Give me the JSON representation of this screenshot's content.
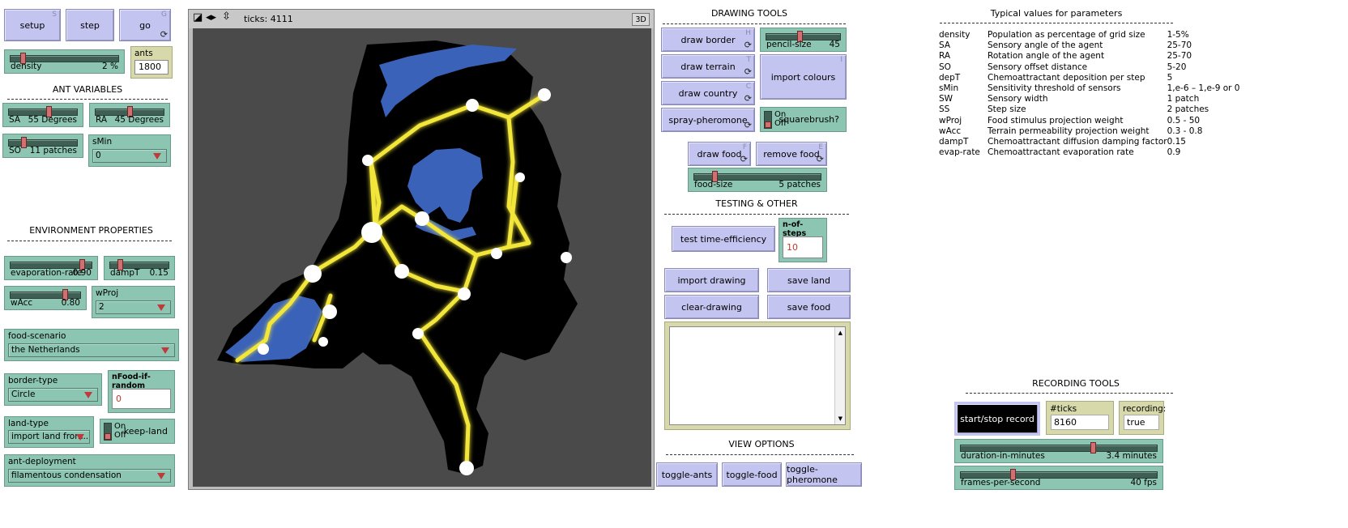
{
  "buttons": {
    "setup": {
      "label": "setup",
      "key": "S"
    },
    "step": {
      "label": "step"
    },
    "go": {
      "label": "go",
      "key": "G"
    }
  },
  "density": {
    "label": "density",
    "value": "2 %",
    "fraction": 0.1
  },
  "ants": {
    "label": "ants",
    "value": "1800"
  },
  "sections": {
    "ant_variables": "ANT VARIABLES",
    "environment": "ENVIRONMENT PROPERTIES",
    "drawing_tools": "DRAWING TOOLS",
    "testing": "TESTING & OTHER",
    "view_options": "VIEW OPTIONS",
    "typical_values": "Typical values for parameters",
    "recording_tools": "RECORDING TOOLS"
  },
  "sliders": {
    "sa": {
      "label": "SA",
      "value": "55 Degrees",
      "fraction": 0.6
    },
    "ra": {
      "label": "RA",
      "value": "45 Degrees",
      "fraction": 0.5
    },
    "so": {
      "label": "SO",
      "value": "11 patches",
      "fraction": 0.2
    },
    "evaporation": {
      "label": "evaporation-rate",
      "value": "0.90",
      "fraction": 0.9
    },
    "dampt": {
      "label": "dampT",
      "value": "0.15",
      "fraction": 0.15
    },
    "wacc": {
      "label": "wAcc",
      "value": "0.80",
      "fraction": 0.8
    },
    "pencil": {
      "label": "pencil-size",
      "value": "45",
      "fraction": 0.45
    },
    "food_size": {
      "label": "food-size",
      "value": "5 patches",
      "fraction": 0.15
    },
    "duration": {
      "label": "duration-in-minutes",
      "value": "3.4 minutes",
      "fraction": 0.68
    },
    "fps": {
      "label": "frames-per-second",
      "value": "40 fps",
      "fraction": 0.26
    }
  },
  "choosers": {
    "smin": {
      "label": "sMin",
      "value": "0"
    },
    "wproj": {
      "label": "wProj",
      "value": "2"
    },
    "food_scenario": {
      "label": "food-scenario",
      "value": "the Netherlands"
    },
    "border_type": {
      "label": "border-type",
      "value": "Circle"
    },
    "land_type": {
      "label": "land-type",
      "value": "import land from..."
    },
    "ant_deployment": {
      "label": "ant-deployment",
      "value": "filamentous condensation"
    }
  },
  "inputs": {
    "nfood": {
      "label": "nFood-if-random",
      "value": "0"
    },
    "nsteps": {
      "label": "n-of-steps",
      "value": "10"
    }
  },
  "switches": {
    "keep_land": {
      "label": "keep-land",
      "on": "On",
      "off": "Off"
    },
    "squarebrush": {
      "label": "squarebrush?",
      "on": "On",
      "off": "Off"
    }
  },
  "view": {
    "ticks": "ticks: 4111",
    "btn3d": "3D"
  },
  "draw_buttons": {
    "draw_border": {
      "label": "draw border",
      "key": "H"
    },
    "draw_terrain": {
      "label": "draw terrain",
      "key": "T"
    },
    "draw_country": {
      "label": "draw country",
      "key": "C"
    },
    "spray": {
      "label": "spray-pheromone"
    },
    "import_colours": {
      "label": "import colours",
      "key": "I"
    },
    "draw_food": {
      "label": "draw food",
      "key": "F"
    },
    "remove_food": {
      "label": "remove food",
      "key": "E"
    },
    "test_eff": {
      "label": "test time-efficiency"
    },
    "import_drawing": {
      "label": "import drawing"
    },
    "save_land": {
      "label": "save land"
    },
    "clear_drawing": {
      "label": "clear-drawing"
    },
    "save_food": {
      "label": "save food"
    },
    "toggle_ants": {
      "label": "toggle-ants"
    },
    "toggle_food": {
      "label": "toggle-food"
    },
    "toggle_pheromone": {
      "label": "toggle-pheromone"
    },
    "start_stop": {
      "label": "start/stop record"
    }
  },
  "monitors": {
    "ticks_rec": {
      "label": "#ticks recording:",
      "value": "8160"
    },
    "recording": {
      "label": "recording:",
      "value": "true"
    }
  },
  "params": [
    [
      "density",
      "Population as percentage of grid size",
      "1-5%"
    ],
    [
      "SA",
      "Sensory angle of the agent",
      "25-70"
    ],
    [
      "RA",
      "Rotation angle of the agent",
      "25-70"
    ],
    [
      "SO",
      "Sensory offset distance",
      "5-20"
    ],
    [
      "depT",
      "Chemoattractant deposition per step",
      "5"
    ],
    [
      "sMin",
      "Sensitivity threshold of sensors",
      "1,e-6 – 1,e-9 or 0"
    ],
    [
      "SW",
      "Sensory width",
      "1 patch"
    ],
    [
      "SS",
      "Step size",
      "2 patches"
    ],
    [
      "wProj",
      "Food stimulus projection weight",
      "0.5 - 50"
    ],
    [
      "wAcc",
      "Terrain permeability projection weight",
      "0.3 - 0.8"
    ],
    [
      "dampT",
      "Chemoattractant diffusion damping factor",
      "0.15"
    ],
    [
      "evap-rate",
      "Chemoattractant evaporation rate",
      "0.9"
    ]
  ],
  "icons": {
    "forever": "forever-arrows-icon",
    "dropdown": "dropdown-triangle-icon"
  },
  "colors": {
    "button": "#c4c4f0",
    "slider": "#8cc6b2",
    "monitor": "#d7d9aa",
    "water": "#3a62b8",
    "network": "#f2e63a"
  }
}
